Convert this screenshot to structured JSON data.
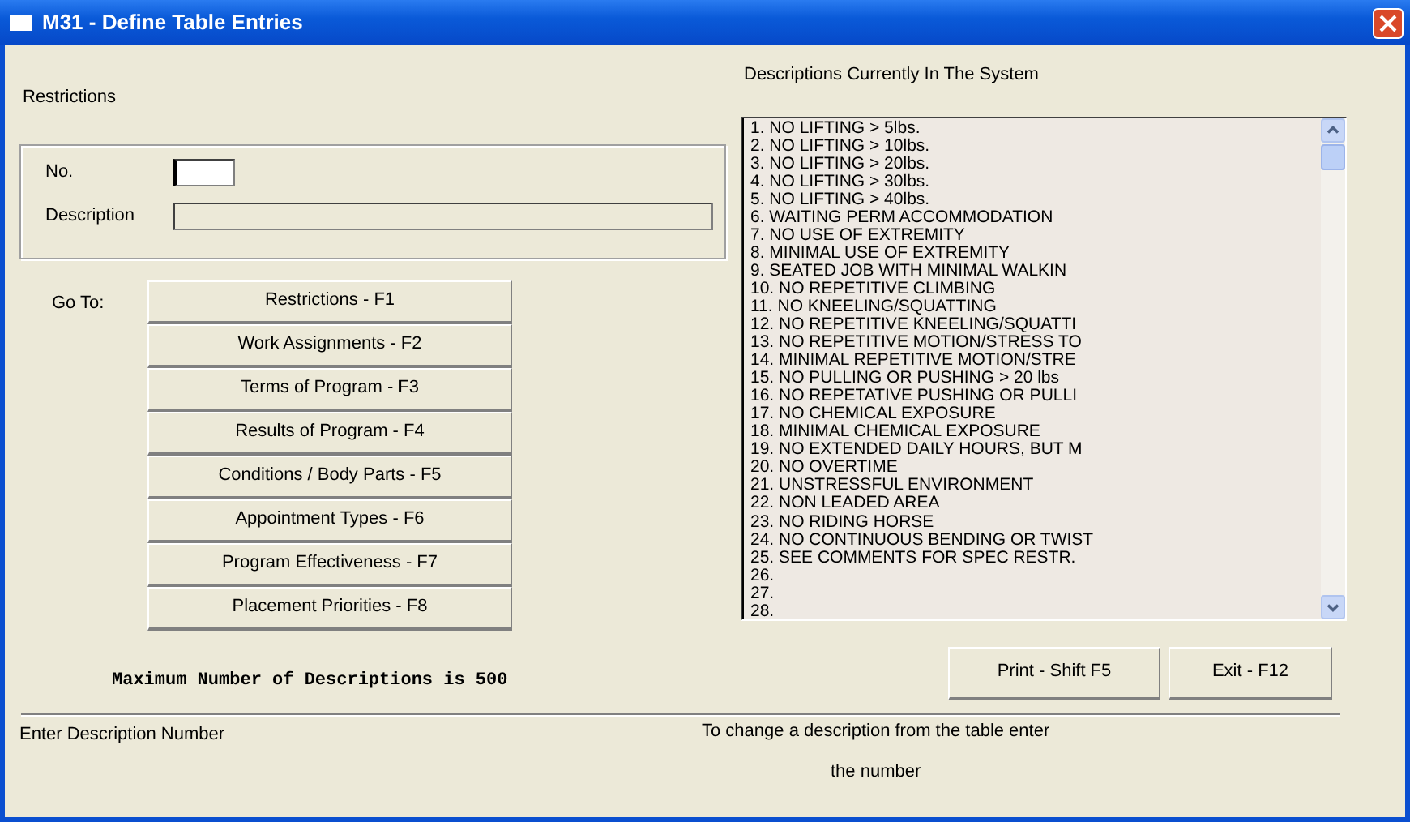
{
  "window": {
    "title": "M31 - Define Table Entries"
  },
  "restrictions": {
    "heading": "Restrictions",
    "no_label": "No.",
    "description_label": "Description"
  },
  "goto": {
    "label": "Go To:",
    "buttons": [
      "Restrictions - F1",
      "Work Assignments - F2",
      "Terms of Program - F3",
      "Results of Program - F4",
      "Conditions / Body Parts - F5",
      "Appointment Types - F6",
      "Program Effectiveness - F7",
      "Placement Priorities - F8"
    ]
  },
  "max_note": "Maximum Number of Descriptions is 500",
  "descriptions": {
    "heading": "Descriptions Currently In The System",
    "items": [
      "1. NO LIFTING > 5lbs.",
      "2. NO LIFTING > 10lbs.",
      "3. NO LIFTING > 20lbs.",
      "4. NO LIFTING > 30lbs.",
      "5. NO LIFTING > 40lbs.",
      "6. WAITING PERM ACCOMMODATION",
      "7. NO USE OF EXTREMITY",
      "8. MINIMAL USE OF EXTREMITY",
      "9. SEATED JOB WITH MINIMAL WALKIN",
      "10. NO REPETITIVE CLIMBING",
      "11. NO KNEELING/SQUATTING",
      "12. NO REPETITIVE KNEELING/SQUATTI",
      "13. NO REPETITIVE MOTION/STRESS TO",
      "14. MINIMAL REPETITIVE MOTION/STRE",
      "15. NO PULLING OR PUSHING > 20 lbs",
      "16. NO REPETATIVE PUSHING OR PULLI",
      "17. NO CHEMICAL EXPOSURE",
      "18. MINIMAL CHEMICAL EXPOSURE",
      "19. NO EXTENDED DAILY HOURS, BUT M",
      "20. NO OVERTIME",
      "21. UNSTRESSFUL ENVIRONMENT",
      "22. NON LEADED AREA",
      "23. NO RIDING HORSE",
      "24. NO CONTINUOUS BENDING OR TWIST",
      "25. SEE COMMENTS FOR SPEC RESTR.",
      "26.",
      "27.",
      "28."
    ]
  },
  "actions": [
    "Print - Shift F5",
    "Exit - F12"
  ],
  "status_bar": {
    "prompt": "Enter Description Number",
    "hint": [
      "To change a description from the table enter",
      "the number"
    ]
  }
}
